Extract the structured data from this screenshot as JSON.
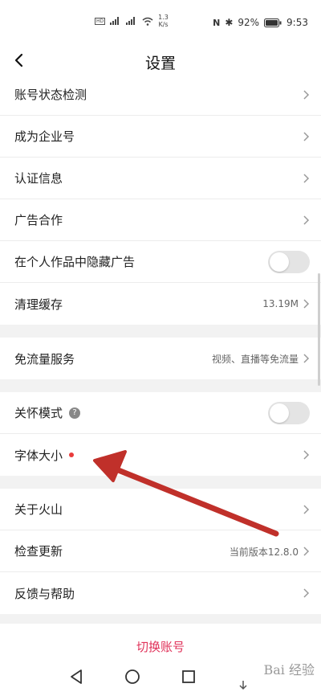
{
  "status_bar": {
    "net_speed": "1.3",
    "net_unit": "K/s",
    "battery": "92%",
    "time": "9:53"
  },
  "header": {
    "title": "设置"
  },
  "groups": [
    {
      "rows": [
        {
          "label": "账号状态检测",
          "value": ""
        },
        {
          "label": "成为企业号",
          "value": ""
        },
        {
          "label": "认证信息",
          "value": ""
        },
        {
          "label": "广告合作",
          "value": ""
        },
        {
          "label": "在个人作品中隐藏广告",
          "toggle": false
        },
        {
          "label": "清理缓存",
          "value": "13.19M"
        }
      ]
    },
    {
      "rows": [
        {
          "label": "免流量服务",
          "value": "视频、直播等免流量"
        }
      ]
    },
    {
      "rows": [
        {
          "label": "关怀模式",
          "toggle": false,
          "help": "?"
        },
        {
          "label": "字体大小",
          "value": "",
          "reddot": true
        }
      ]
    },
    {
      "rows": [
        {
          "label": "关于火山",
          "value": ""
        },
        {
          "label": "检查更新",
          "value": "当前版本12.8.0"
        },
        {
          "label": "反馈与帮助",
          "value": ""
        }
      ]
    }
  ],
  "footer": {
    "switch_account": "切换账号"
  },
  "watermark": "Bai 经验",
  "colors": {
    "accent": "#e0325a",
    "arrow": "#c0302a",
    "dot": "#e93b3b"
  }
}
